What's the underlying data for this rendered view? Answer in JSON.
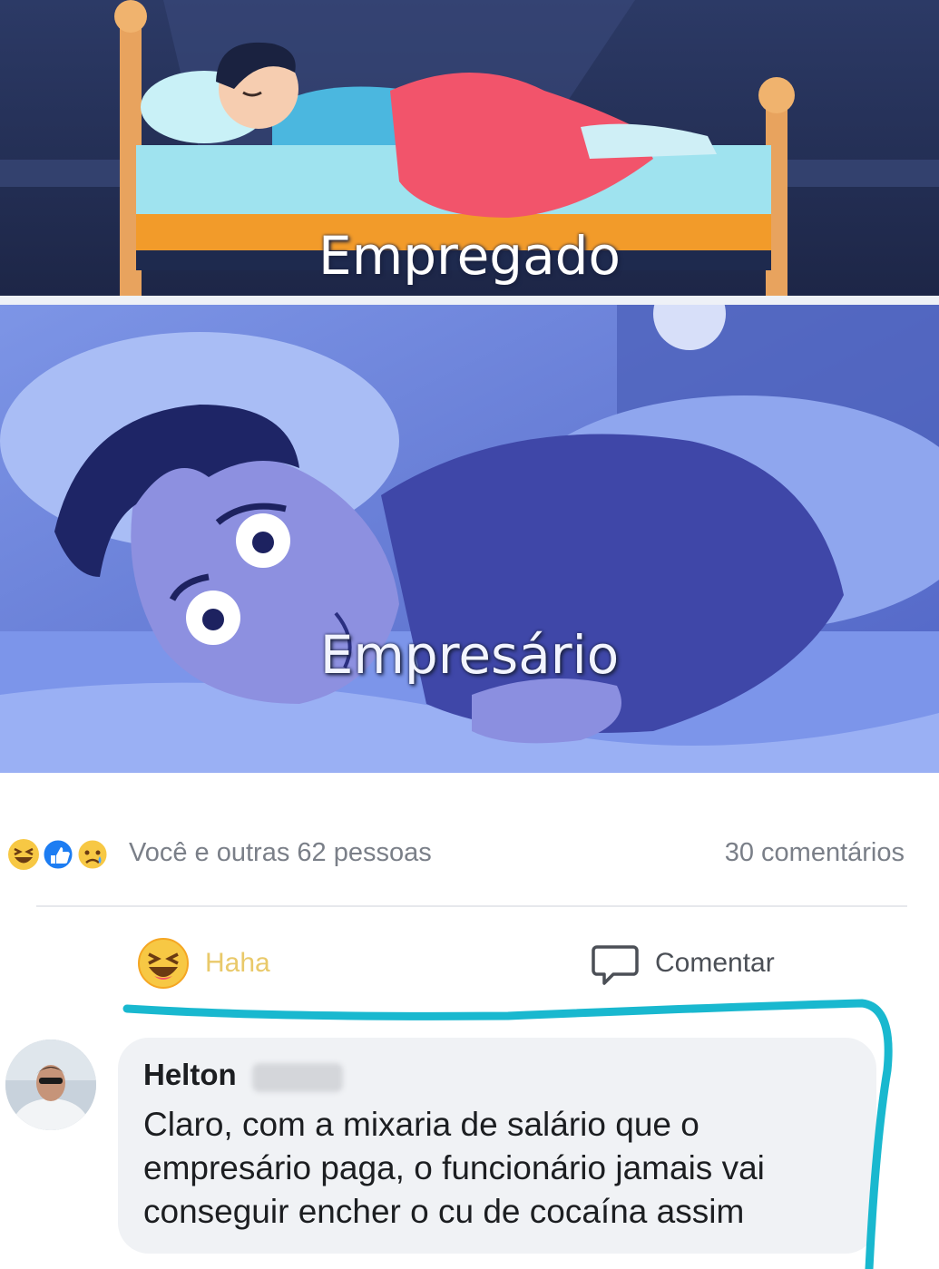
{
  "meme": {
    "top_caption": "Empregado",
    "bottom_caption": "Empresário"
  },
  "post_stats": {
    "reactions_text": "Você e outras 62 pessoas",
    "comments_count": "30 comentários",
    "reaction_icons": [
      "haha-icon",
      "like-icon",
      "sad-icon"
    ]
  },
  "actions": {
    "haha_label": "Haha",
    "comment_label": "Comentar"
  },
  "comment": {
    "author": "Helton",
    "lines": [
      "Claro, com a mixaria de salário que o",
      "empresário paga, o funcionário jamais vai",
      "conseguir encher o cu de cocaína assim"
    ]
  },
  "colors": {
    "highlight_stroke": "#19b8cf",
    "haha_active": "#e9c96a",
    "night_blue": "#5a6fd0"
  }
}
